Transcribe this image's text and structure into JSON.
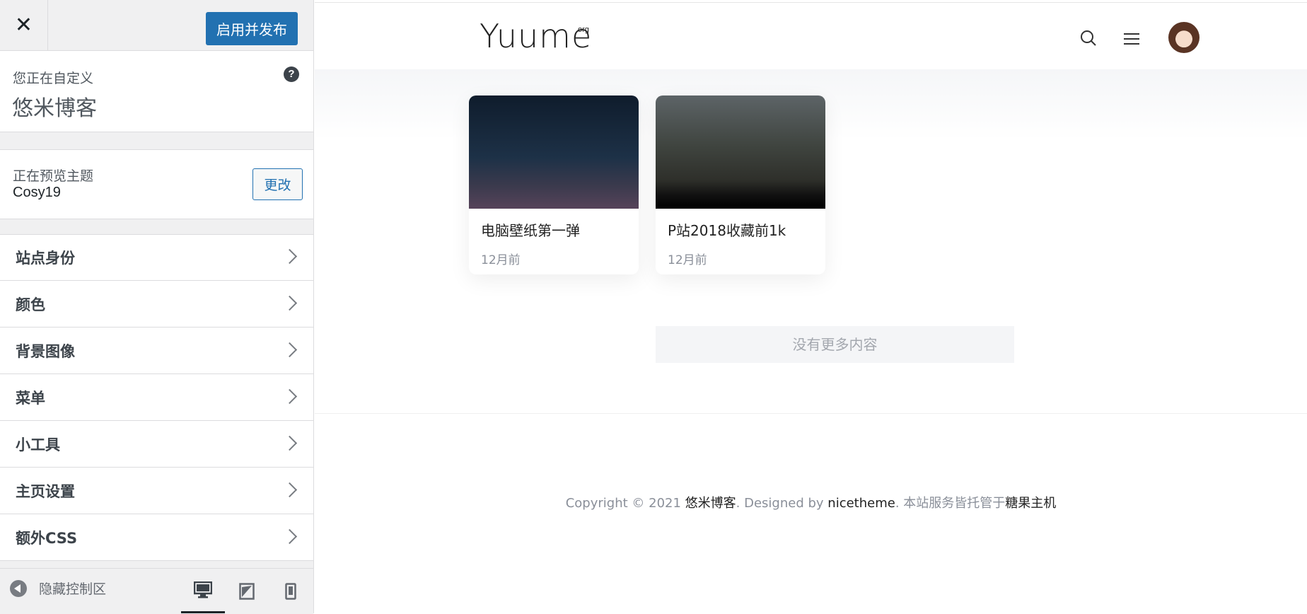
{
  "sidebar": {
    "close_label": "✕",
    "publish_label": "启用并发布",
    "custom_label": "您正在自定义",
    "site_name": "悠米博客",
    "help_label": "?",
    "theme_label": "正在预览主题",
    "theme_name": "Cosy19",
    "change_label": "更改",
    "sections": [
      {
        "label": "站点身份"
      },
      {
        "label": "颜色"
      },
      {
        "label": "背景图像"
      },
      {
        "label": "菜单"
      },
      {
        "label": "小工具"
      },
      {
        "label": "主页设置"
      },
      {
        "label": "额外CSS"
      }
    ],
    "hide_label": "隐藏控制区"
  },
  "preview": {
    "logo": "Yuume",
    "logo_sup": "org",
    "cards": [
      {
        "title": "电脑壁纸第一弹",
        "date": "12月前"
      },
      {
        "title": "P站2018收藏前1k",
        "date": "12月前"
      }
    ],
    "no_more": "没有更多内容",
    "footer": {
      "prefix": "Copyright © 2021 ",
      "site": "悠米博客",
      "designed": ". Designed by ",
      "designer": "nicetheme",
      "hosted": ". 本站服务皆托管于",
      "host": "糖果主机"
    }
  },
  "colors": {
    "accent": "#2271b1",
    "panel_bg": "#f0f0f1"
  }
}
